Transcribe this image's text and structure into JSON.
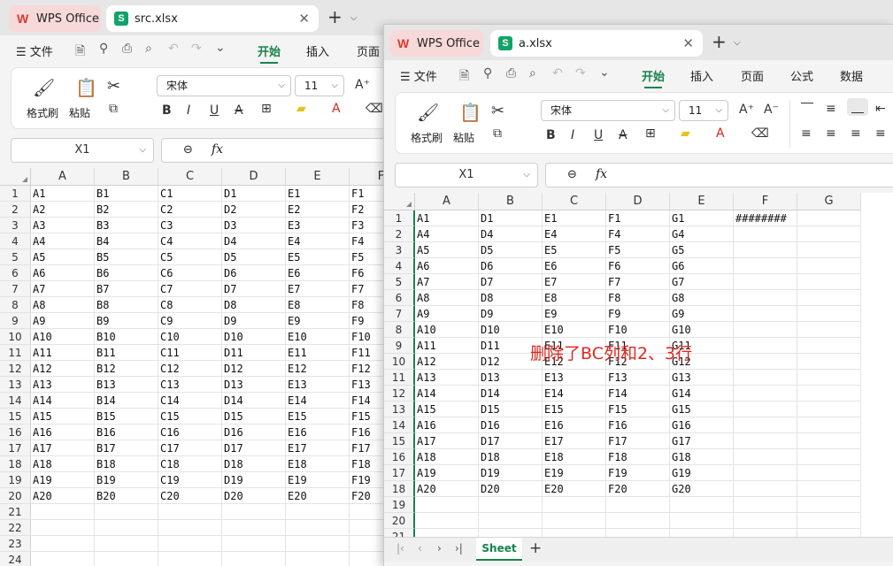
{
  "win1": {
    "home_tab": "WPS Office",
    "file_tab": "src.xlsx",
    "menu_file": "文件",
    "menu": [
      "开始",
      "插入",
      "页面"
    ],
    "format_painter": "格式刷",
    "paste": "粘贴",
    "font_name": "宋体",
    "font_size": "11",
    "name_box": "X1",
    "fx": "fx",
    "columns": [
      "A",
      "B",
      "C",
      "D",
      "E",
      "F"
    ],
    "rows": [
      [
        "A1",
        "B1",
        "C1",
        "D1",
        "E1",
        "F1"
      ],
      [
        "A2",
        "B2",
        "C2",
        "D2",
        "E2",
        "F2"
      ],
      [
        "A3",
        "B3",
        "C3",
        "D3",
        "E3",
        "F3"
      ],
      [
        "A4",
        "B4",
        "C4",
        "D4",
        "E4",
        "F4"
      ],
      [
        "A5",
        "B5",
        "C5",
        "D5",
        "E5",
        "F5"
      ],
      [
        "A6",
        "B6",
        "C6",
        "D6",
        "E6",
        "F6"
      ],
      [
        "A7",
        "B7",
        "C7",
        "D7",
        "E7",
        "F7"
      ],
      [
        "A8",
        "B8",
        "C8",
        "D8",
        "E8",
        "F8"
      ],
      [
        "A9",
        "B9",
        "C9",
        "D9",
        "E9",
        "F9"
      ],
      [
        "A10",
        "B10",
        "C10",
        "D10",
        "E10",
        "F10"
      ],
      [
        "A11",
        "B11",
        "C11",
        "D11",
        "E11",
        "F11"
      ],
      [
        "A12",
        "B12",
        "C12",
        "D12",
        "E12",
        "F12"
      ],
      [
        "A13",
        "B13",
        "C13",
        "D13",
        "E13",
        "F13"
      ],
      [
        "A14",
        "B14",
        "C14",
        "D14",
        "E14",
        "F14"
      ],
      [
        "A15",
        "B15",
        "C15",
        "D15",
        "E15",
        "F15"
      ],
      [
        "A16",
        "B16",
        "C16",
        "D16",
        "E16",
        "F16"
      ],
      [
        "A17",
        "B17",
        "C17",
        "D17",
        "E17",
        "F17"
      ],
      [
        "A18",
        "B18",
        "C18",
        "D18",
        "E18",
        "F18"
      ],
      [
        "A19",
        "B19",
        "C19",
        "D19",
        "E19",
        "F19"
      ],
      [
        "A20",
        "B20",
        "C20",
        "D20",
        "E20",
        "F20"
      ],
      [
        "",
        "",
        "",
        "",
        "",
        ""
      ],
      [
        "",
        "",
        "",
        "",
        "",
        ""
      ],
      [
        "",
        "",
        "",
        "",
        "",
        ""
      ],
      [
        "",
        "",
        "",
        "",
        "",
        ""
      ]
    ]
  },
  "win2": {
    "home_tab": "WPS Office",
    "file_tab": "a.xlsx",
    "menu_file": "文件",
    "menu": [
      "开始",
      "插入",
      "页面",
      "公式",
      "数据"
    ],
    "format_painter": "格式刷",
    "paste": "粘贴",
    "font_name": "宋体",
    "font_size": "11",
    "name_box": "X1",
    "fx": "fx",
    "columns": [
      "A",
      "B",
      "C",
      "D",
      "E",
      "F",
      "G"
    ],
    "rows": [
      [
        "A1",
        "D1",
        "E1",
        "F1",
        "G1",
        "########",
        ""
      ],
      [
        "A4",
        "D4",
        "E4",
        "F4",
        "G4",
        "",
        ""
      ],
      [
        "A5",
        "D5",
        "E5",
        "F5",
        "G5",
        "",
        ""
      ],
      [
        "A6",
        "D6",
        "E6",
        "F6",
        "G6",
        "",
        ""
      ],
      [
        "A7",
        "D7",
        "E7",
        "F7",
        "G7",
        "",
        ""
      ],
      [
        "A8",
        "D8",
        "E8",
        "F8",
        "G8",
        "",
        ""
      ],
      [
        "A9",
        "D9",
        "E9",
        "F9",
        "G9",
        "",
        ""
      ],
      [
        "A10",
        "D10",
        "E10",
        "F10",
        "G10",
        "",
        ""
      ],
      [
        "A11",
        "D11",
        "E11",
        "F11",
        "G11",
        "",
        ""
      ],
      [
        "A12",
        "D12",
        "E12",
        "F12",
        "G12",
        "",
        ""
      ],
      [
        "A13",
        "D13",
        "E13",
        "F13",
        "G13",
        "",
        ""
      ],
      [
        "A14",
        "D14",
        "E14",
        "F14",
        "G14",
        "",
        ""
      ],
      [
        "A15",
        "D15",
        "E15",
        "F15",
        "G15",
        "",
        ""
      ],
      [
        "A16",
        "D16",
        "E16",
        "F16",
        "G16",
        "",
        ""
      ],
      [
        "A17",
        "D17",
        "E17",
        "F17",
        "G17",
        "",
        ""
      ],
      [
        "A18",
        "D18",
        "E18",
        "F18",
        "G18",
        "",
        ""
      ],
      [
        "A19",
        "D19",
        "E19",
        "F19",
        "G19",
        "",
        ""
      ],
      [
        "A20",
        "D20",
        "E20",
        "F20",
        "G20",
        "",
        ""
      ],
      [
        "",
        "",
        "",
        "",
        "",
        "",
        ""
      ],
      [
        "",
        "",
        "",
        "",
        "",
        "",
        ""
      ],
      [
        "",
        "",
        "",
        "",
        "",
        "",
        ""
      ]
    ],
    "sheet_tab": "Sheet",
    "annotation": "删除了BC列和2、3行"
  },
  "colors": {
    "accent": "#16834c",
    "annotation": "#e0281f",
    "brand": "#d93a2d"
  }
}
